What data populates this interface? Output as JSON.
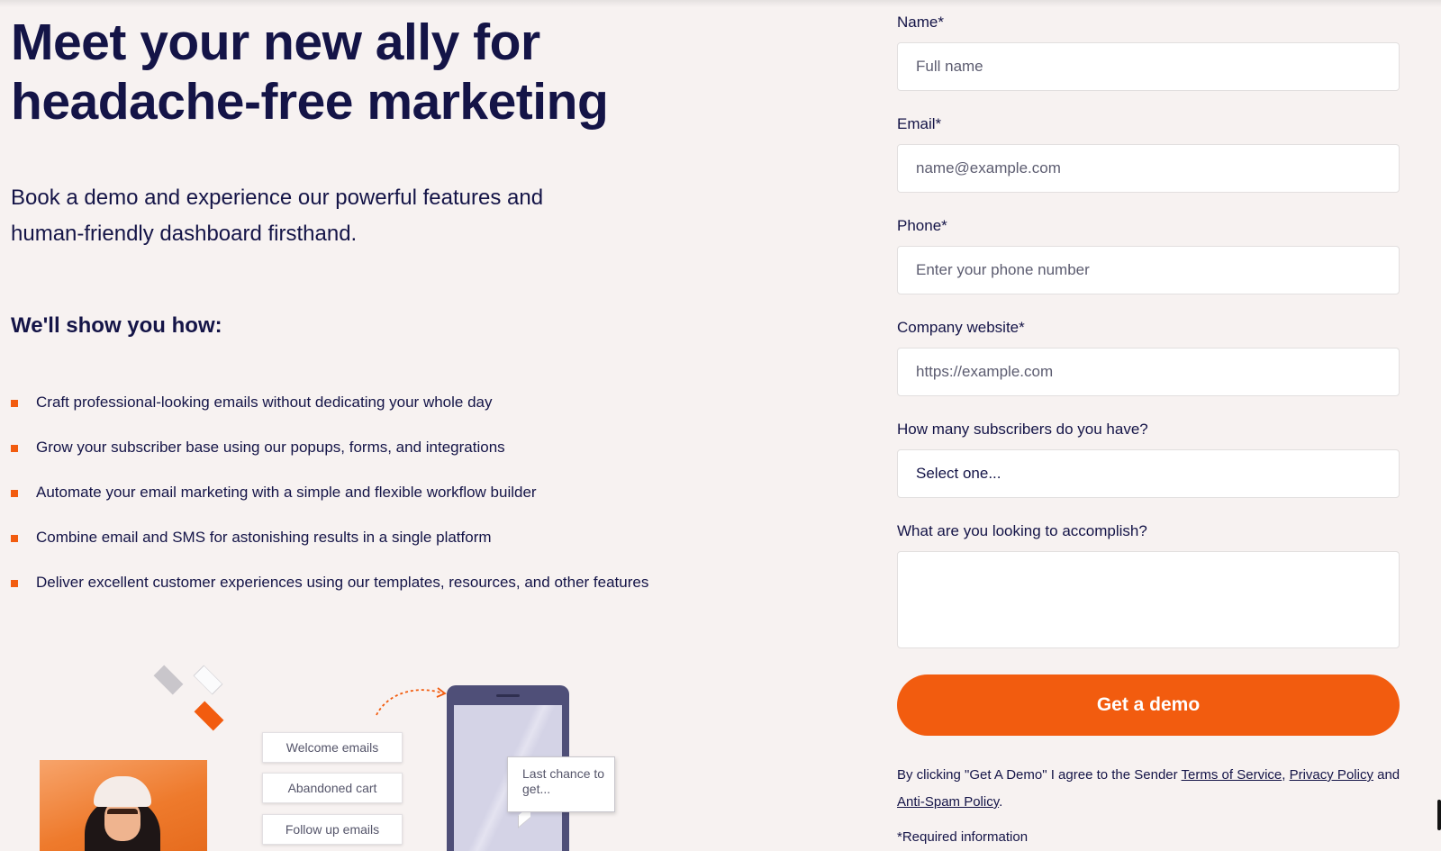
{
  "hero": {
    "title": "Meet your new ally for headache-free marketing",
    "subtitle": "Book a demo and experience our powerful features and human-friendly dashboard firsthand."
  },
  "how": {
    "heading": "We'll show you how:",
    "items": [
      "Craft professional-looking emails without dedicating your whole day",
      "Grow your subscriber base using our popups, forms, and integrations",
      "Automate your email marketing with a simple and flexible workflow builder",
      "Combine email and SMS for astonishing results in a single platform",
      "Deliver excellent customer experiences using our templates, resources, and other features"
    ]
  },
  "illustration": {
    "flow_buttons": [
      "Welcome emails",
      "Abandoned cart",
      "Follow up emails"
    ],
    "bubble_text": "Last chance to get..."
  },
  "form": {
    "name": {
      "label": "Name*",
      "placeholder": "Full name"
    },
    "email": {
      "label": "Email*",
      "placeholder": "name@example.com"
    },
    "phone": {
      "label": "Phone*",
      "placeholder": "Enter your phone number"
    },
    "website": {
      "label": "Company website*",
      "placeholder": "https://example.com"
    },
    "subscribers": {
      "label": "How many subscribers do you have?",
      "value": "Select one..."
    },
    "goal": {
      "label": "What are you looking to accomplish?"
    },
    "submit_label": "Get a demo",
    "consent": {
      "prefix": "By clicking \"Get A Demo\" I agree to the Sender ",
      "terms": "Terms of Service",
      "comma": ", ",
      "privacy": "Privacy Policy",
      "and": " and ",
      "antispam": "Anti-Spam Policy",
      "period": "."
    },
    "required_note": "*Required information"
  },
  "colors": {
    "accent": "#f25c0f",
    "text": "#141447",
    "background": "#f7f2f1"
  }
}
